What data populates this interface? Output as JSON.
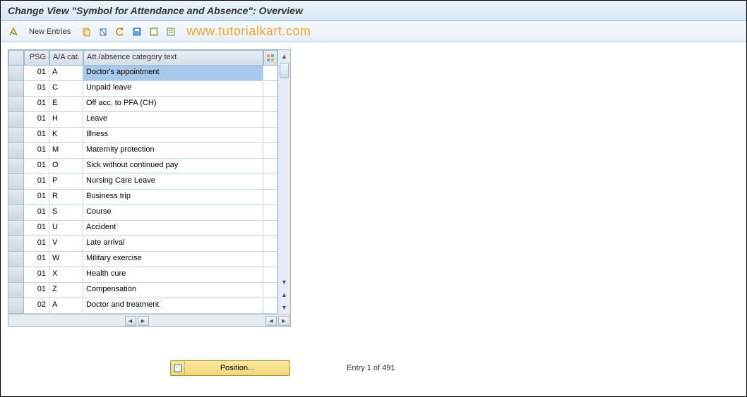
{
  "title": "Change View \"Symbol for Attendance and Absence\": Overview",
  "toolbar": {
    "new_entries": "New Entries"
  },
  "watermark": "www.tutorialkart.com",
  "table": {
    "headers": {
      "psg": "PSG",
      "aa": "A/A cat.",
      "text": "Att./absence category text"
    },
    "rows": [
      {
        "psg": "01",
        "aa": "A",
        "text": "Doctor's appointment",
        "selected": true
      },
      {
        "psg": "01",
        "aa": "C",
        "text": "Unpaid leave"
      },
      {
        "psg": "01",
        "aa": "E",
        "text": "Off acc. to PFA (CH)"
      },
      {
        "psg": "01",
        "aa": "H",
        "text": "Leave"
      },
      {
        "psg": "01",
        "aa": "K",
        "text": "Illness"
      },
      {
        "psg": "01",
        "aa": "M",
        "text": "Maternity protection"
      },
      {
        "psg": "01",
        "aa": "O",
        "text": "Sick without continued pay"
      },
      {
        "psg": "01",
        "aa": "P",
        "text": "Nursing Care Leave"
      },
      {
        "psg": "01",
        "aa": "R",
        "text": "Business trip"
      },
      {
        "psg": "01",
        "aa": "S",
        "text": "Course"
      },
      {
        "psg": "01",
        "aa": "U",
        "text": "Accident"
      },
      {
        "psg": "01",
        "aa": "V",
        "text": "Late arrival"
      },
      {
        "psg": "01",
        "aa": "W",
        "text": "Military exercise"
      },
      {
        "psg": "01",
        "aa": "X",
        "text": "Health cure"
      },
      {
        "psg": "01",
        "aa": "Z",
        "text": "Compensation"
      },
      {
        "psg": "02",
        "aa": "A",
        "text": "Doctor and treatment"
      }
    ]
  },
  "footer": {
    "position_label": "Position...",
    "entry_text": "Entry 1 of 491"
  }
}
